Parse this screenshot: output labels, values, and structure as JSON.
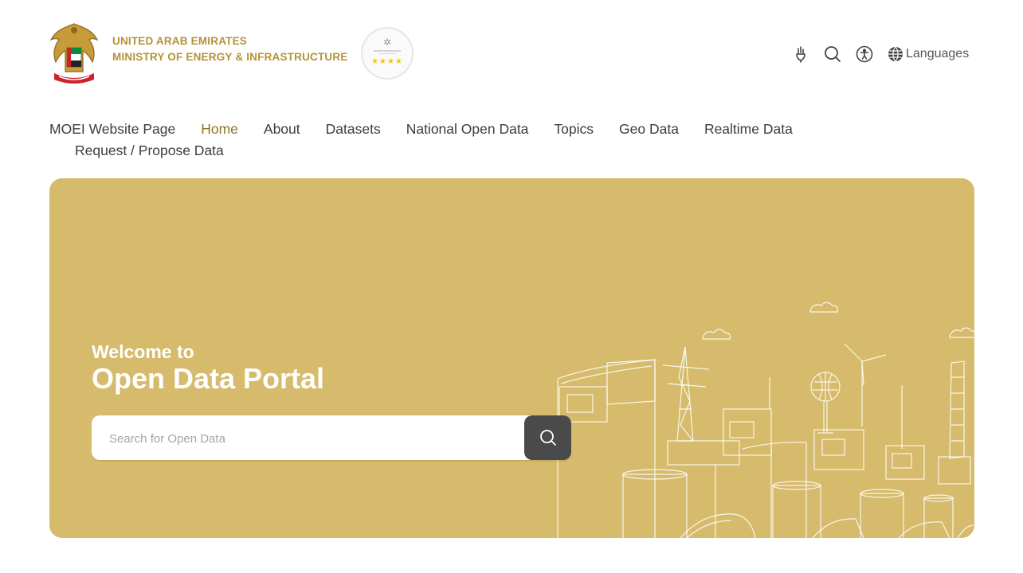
{
  "header": {
    "org_line1": "UNITED ARAB EMIRATES",
    "org_line2": "MINISTRY OF ENERGY & INFRASTRUCTURE",
    "languages_label": "Languages"
  },
  "nav": {
    "items": [
      "MOEI Website Page",
      "Home",
      "About",
      "Datasets",
      "National Open Data",
      "Topics",
      "Geo Data",
      "Realtime Data",
      "Request / Propose Data"
    ],
    "active": "Home"
  },
  "hero": {
    "welcome": "Welcome to",
    "title": "Open Data Portal",
    "search_placeholder": "Search for Open Data",
    "background_color": "#d6bb6c"
  },
  "colors": {
    "brand_gold": "#b39237",
    "active_nav": "#8e7320",
    "search_button": "#4a4a4a"
  },
  "icons": [
    "emblem-icon",
    "rating-badge-icon",
    "sign-language-icon",
    "search-icon",
    "accessibility-icon",
    "globe-icon",
    "search-button-icon"
  ]
}
